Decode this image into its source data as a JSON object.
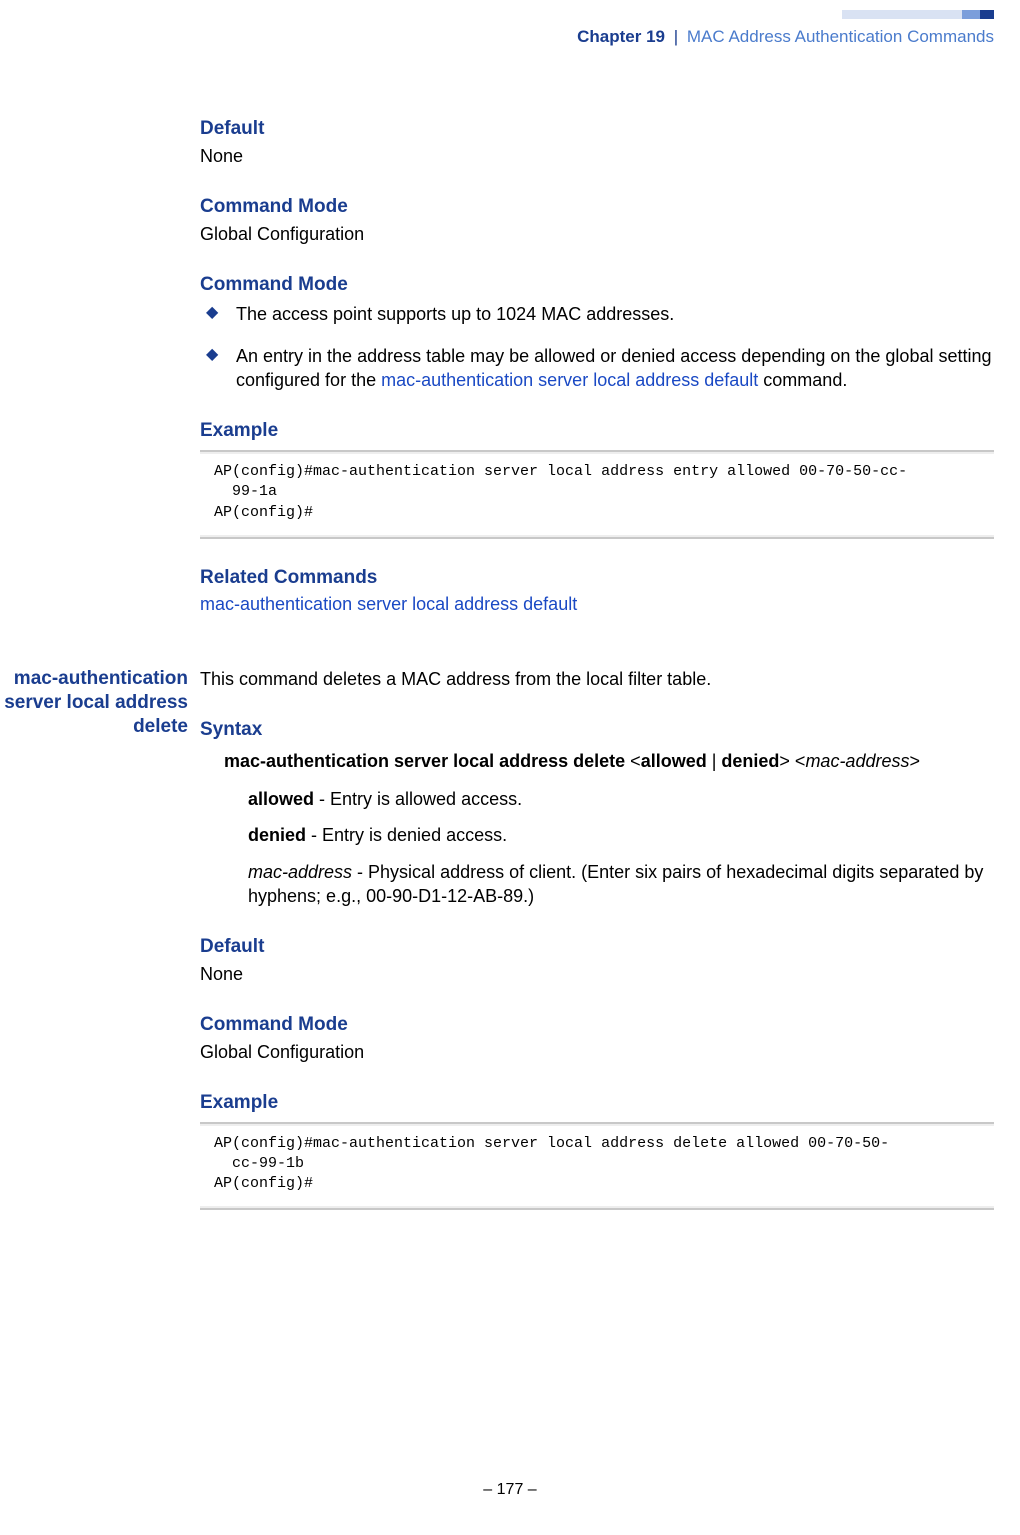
{
  "header": {
    "chapter": "Chapter 19",
    "sep": "|",
    "topic": "MAC Address Authentication Commands"
  },
  "sec1": {
    "default_h": "Default",
    "default_v": "None",
    "cmdmode1_h": "Command Mode",
    "cmdmode1_v": "Global Configuration",
    "cmdmode2_h": "Command Mode",
    "bullet1": "The access point supports up to 1024 MAC addresses.",
    "bullet2_a": "An entry in the address table may be allowed or denied access depending on the global setting configured for the ",
    "bullet2_link": "mac-authentication server local address default",
    "bullet2_b": " command.",
    "example_h": "Example",
    "example_code": "AP(config)#mac-authentication server local address entry allowed 00-70-50-cc-\n  99-1a\nAP(config)#",
    "related_h": "Related Commands",
    "related_link": "mac-authentication server local address default"
  },
  "sec2": {
    "margin_title": "mac-authentication server local address delete",
    "intro": "This command deletes a MAC address from the local filter table.",
    "syntax_h": "Syntax",
    "syntax_cmd_bold1": "mac-authentication server local address delete",
    "syntax_lt1": " <",
    "syntax_allowed": "allowed",
    "syntax_pipe": " | ",
    "syntax_denied": "denied",
    "syntax_gt1": "> <",
    "syntax_macaddr": "mac-address",
    "syntax_gt2": ">",
    "opt_allowed_b": "allowed",
    "opt_allowed_t": " - Entry is allowed access.",
    "opt_denied_b": "denied",
    "opt_denied_t": " - Entry is denied access.",
    "opt_mac_i": "mac-address",
    "opt_mac_t": " - Physical address of client. (Enter six pairs of hexadecimal digits separated by hyphens; e.g., 00-90-D1-12-AB-89.)",
    "default_h": "Default",
    "default_v": "None",
    "cmdmode_h": "Command Mode",
    "cmdmode_v": "Global Configuration",
    "example_h": "Example",
    "example_code": "AP(config)#mac-authentication server local address delete allowed 00-70-50-\n  cc-99-1b\nAP(config)#"
  },
  "footer": {
    "page": "–  177  –"
  }
}
